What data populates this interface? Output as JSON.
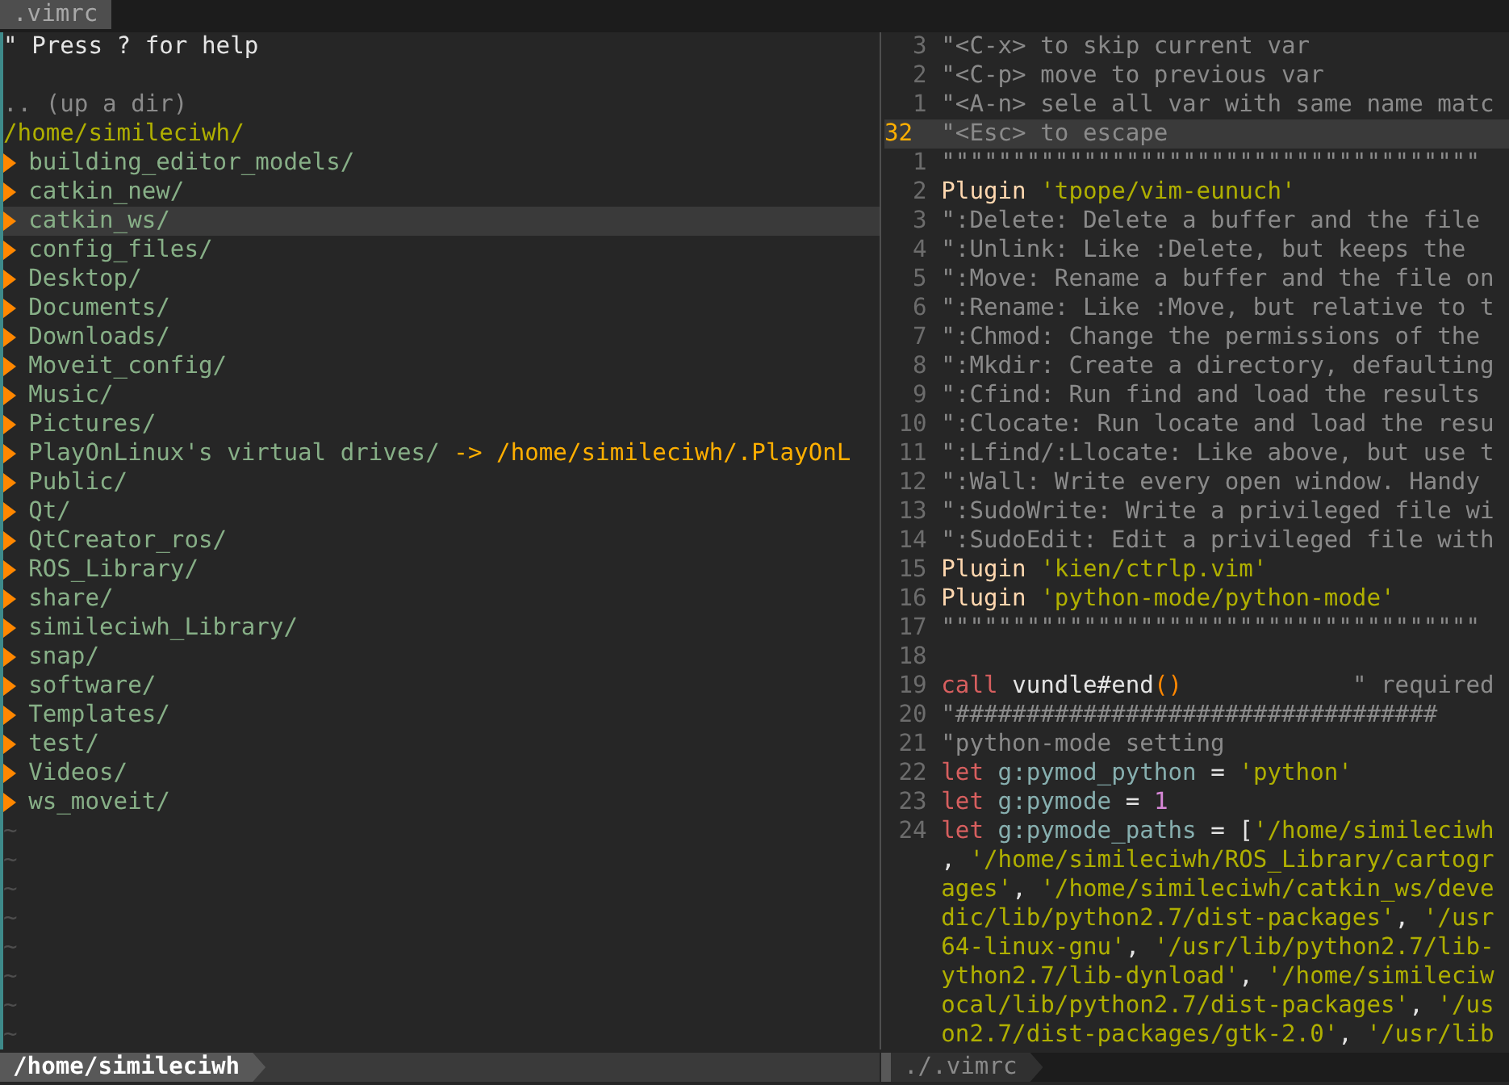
{
  "tabline": {
    "tabs": [
      {
        "label": ".vimrc",
        "selected": true
      }
    ]
  },
  "tree": {
    "help": "\" Press ? for help",
    "up": ".. (up a dir)",
    "root": "/home/simileciwh/",
    "items": [
      {
        "name": "building_editor_models/",
        "selected": false
      },
      {
        "name": "catkin_new/",
        "selected": false
      },
      {
        "name": "catkin_ws/",
        "selected": true
      },
      {
        "name": "config_files/",
        "selected": false
      },
      {
        "name": "Desktop/",
        "selected": false
      },
      {
        "name": "Documents/",
        "selected": false
      },
      {
        "name": "Downloads/",
        "selected": false
      },
      {
        "name": "Moveit_config/",
        "selected": false
      },
      {
        "name": "Music/",
        "selected": false
      },
      {
        "name": "Pictures/",
        "selected": false
      },
      {
        "name": "PlayOnLinux's virtual drives/",
        "selected": false,
        "target": "-> /home/simileciwh/.PlayOnL"
      },
      {
        "name": "Public/",
        "selected": false
      },
      {
        "name": "Qt/",
        "selected": false
      },
      {
        "name": "QtCreator_ros/",
        "selected": false
      },
      {
        "name": "ROS_Library/",
        "selected": false
      },
      {
        "name": "share/",
        "selected": false
      },
      {
        "name": "simileciwh_Library/",
        "selected": false
      },
      {
        "name": "snap/",
        "selected": false
      },
      {
        "name": "software/",
        "selected": false
      },
      {
        "name": "Templates/",
        "selected": false
      },
      {
        "name": "test/",
        "selected": false
      },
      {
        "name": "Videos/",
        "selected": false
      },
      {
        "name": "ws_moveit/",
        "selected": false
      }
    ],
    "tildes": [
      "~",
      "~",
      "~",
      "~",
      "~",
      "~",
      "~",
      "~"
    ]
  },
  "code": {
    "lines": [
      {
        "number": "3",
        "current": false,
        "tokens": [
          {
            "kind": "comment",
            "text": "\"<C-x> to skip current var"
          }
        ]
      },
      {
        "number": "2",
        "current": false,
        "tokens": [
          {
            "kind": "comment",
            "text": "\"<C-p> move to previous var"
          }
        ]
      },
      {
        "number": "1",
        "current": false,
        "tokens": [
          {
            "kind": "comment",
            "text": "\"<A-n> sele all var with same name matc"
          }
        ]
      },
      {
        "number": "32",
        "current": true,
        "tokens": [
          {
            "kind": "comment",
            "text": "\"<Esc> to escape"
          }
        ]
      },
      {
        "number": "1",
        "current": false,
        "tokens": [
          {
            "kind": "comment",
            "text": "\"\"\"\"\"\"\"\"\"\"\"\"\"\"\"\"\"\"\"\"\"\"\"\"\"\"\"\"\"\"\"\"\"\"\"\"\"\""
          }
        ]
      },
      {
        "number": "2",
        "current": false,
        "tokens": [
          {
            "kind": "keyword",
            "text": "Plugin "
          },
          {
            "kind": "string",
            "text": "'tpope/vim-eunuch'"
          }
        ]
      },
      {
        "number": "3",
        "current": false,
        "tokens": [
          {
            "kind": "comment",
            "text": "\":Delete: Delete a buffer and the file"
          }
        ]
      },
      {
        "number": "4",
        "current": false,
        "tokens": [
          {
            "kind": "comment",
            "text": "\":Unlink: Like :Delete, but keeps the"
          }
        ]
      },
      {
        "number": "5",
        "current": false,
        "tokens": [
          {
            "kind": "comment",
            "text": "\":Move: Rename a buffer and the file on"
          }
        ]
      },
      {
        "number": "6",
        "current": false,
        "tokens": [
          {
            "kind": "comment",
            "text": "\":Rename: Like :Move, but relative to t"
          }
        ]
      },
      {
        "number": "7",
        "current": false,
        "tokens": [
          {
            "kind": "comment",
            "text": "\":Chmod: Change the permissions of the"
          }
        ]
      },
      {
        "number": "8",
        "current": false,
        "tokens": [
          {
            "kind": "comment",
            "text": "\":Mkdir: Create a directory, defaulting"
          }
        ]
      },
      {
        "number": "9",
        "current": false,
        "tokens": [
          {
            "kind": "comment",
            "text": "\":Cfind: Run find and load the results"
          }
        ]
      },
      {
        "number": "10",
        "current": false,
        "tokens": [
          {
            "kind": "comment",
            "text": "\":Clocate: Run locate and load the resu"
          }
        ]
      },
      {
        "number": "11",
        "current": false,
        "tokens": [
          {
            "kind": "comment",
            "text": "\":Lfind/:Llocate: Like above, but use t"
          }
        ]
      },
      {
        "number": "12",
        "current": false,
        "tokens": [
          {
            "kind": "comment",
            "text": "\":Wall: Write every open window. Handy"
          }
        ]
      },
      {
        "number": "13",
        "current": false,
        "tokens": [
          {
            "kind": "comment",
            "text": "\":SudoWrite: Write a privileged file wi"
          }
        ]
      },
      {
        "number": "14",
        "current": false,
        "tokens": [
          {
            "kind": "comment",
            "text": "\":SudoEdit: Edit a privileged file with"
          }
        ]
      },
      {
        "number": "15",
        "current": false,
        "tokens": [
          {
            "kind": "keyword",
            "text": "Plugin "
          },
          {
            "kind": "string",
            "text": "'kien/ctrlp.vim'"
          }
        ]
      },
      {
        "number": "16",
        "current": false,
        "tokens": [
          {
            "kind": "keyword",
            "text": "Plugin "
          },
          {
            "kind": "string",
            "text": "'python-mode/python-mode'"
          }
        ]
      },
      {
        "number": "17",
        "current": false,
        "tokens": [
          {
            "kind": "comment",
            "text": "\"\"\"\"\"\"\"\"\"\"\"\"\"\"\"\"\"\"\"\"\"\"\"\"\"\"\"\"\"\"\"\"\"\"\"\"\"\""
          }
        ]
      },
      {
        "number": "18",
        "current": false
      },
      {
        "number": "19",
        "current": false,
        "tokens": [
          {
            "kind": "statement",
            "text": "call "
          },
          {
            "kind": "function",
            "text": "vundle#end"
          },
          {
            "kind": "paren",
            "text": "()"
          },
          {
            "kind": "comment",
            "text": "            \" required"
          }
        ]
      },
      {
        "number": "20",
        "current": false,
        "tokens": [
          {
            "kind": "comment",
            "text": "\"##################################"
          }
        ]
      },
      {
        "number": "21",
        "current": false,
        "tokens": [
          {
            "kind": "comment",
            "text": "\"python-mode setting"
          }
        ]
      },
      {
        "number": "22",
        "current": false,
        "tokens": [
          {
            "kind": "statement",
            "text": "let "
          },
          {
            "kind": "identifier",
            "text": "g:pymod_python"
          },
          {
            "kind": "operator",
            "text": " = "
          },
          {
            "kind": "string",
            "text": "'python'"
          }
        ]
      },
      {
        "number": "23",
        "current": false,
        "tokens": [
          {
            "kind": "statement",
            "text": "let "
          },
          {
            "kind": "identifier",
            "text": "g:pymode"
          },
          {
            "kind": "operator",
            "text": " = "
          },
          {
            "kind": "number",
            "text": "1"
          }
        ]
      },
      {
        "number": "24",
        "current": false,
        "tokens": [
          {
            "kind": "statement",
            "text": "let "
          },
          {
            "kind": "identifier",
            "text": "g:pymode_paths"
          },
          {
            "kind": "operator",
            "text": " = ["
          },
          {
            "kind": "string",
            "text": "'/home/simileciwh"
          }
        ]
      },
      {
        "current": false,
        "tokens": [
          {
            "kind": "operator",
            "text": ", "
          },
          {
            "kind": "string",
            "text": "'/home/simileciwh/ROS_Library/cartogr"
          }
        ]
      },
      {
        "current": false,
        "tokens": [
          {
            "kind": "string",
            "text": "ages'"
          },
          {
            "kind": "operator",
            "text": ", "
          },
          {
            "kind": "string",
            "text": "'/home/simileciwh/catkin_ws/deve"
          }
        ]
      },
      {
        "current": false,
        "tokens": [
          {
            "kind": "string",
            "text": "dic/lib/python2.7/dist-packages'"
          },
          {
            "kind": "operator",
            "text": ", "
          },
          {
            "kind": "string",
            "text": "'/usr"
          }
        ]
      },
      {
        "current": false,
        "tokens": [
          {
            "kind": "string",
            "text": "64-linux-gnu'"
          },
          {
            "kind": "operator",
            "text": ", "
          },
          {
            "kind": "string",
            "text": "'/usr/lib/python2.7/lib-"
          }
        ]
      },
      {
        "current": false,
        "tokens": [
          {
            "kind": "string",
            "text": "ython2.7/lib-dynload'"
          },
          {
            "kind": "operator",
            "text": ", "
          },
          {
            "kind": "string",
            "text": "'/home/simileciw"
          }
        ]
      },
      {
        "current": false,
        "tokens": [
          {
            "kind": "string",
            "text": "ocal/lib/python2.7/dist-packages'"
          },
          {
            "kind": "operator",
            "text": ", "
          },
          {
            "kind": "string",
            "text": "'/us"
          }
        ]
      },
      {
        "current": false,
        "tokens": [
          {
            "kind": "string",
            "text": "on2.7/dist-packages/gtk-2.0'"
          },
          {
            "kind": "operator",
            "text": ", "
          },
          {
            "kind": "string",
            "text": "'/usr/lib"
          }
        ]
      }
    ]
  },
  "status": {
    "left": "/home/simileciwh",
    "right": "./.vimrc"
  }
}
